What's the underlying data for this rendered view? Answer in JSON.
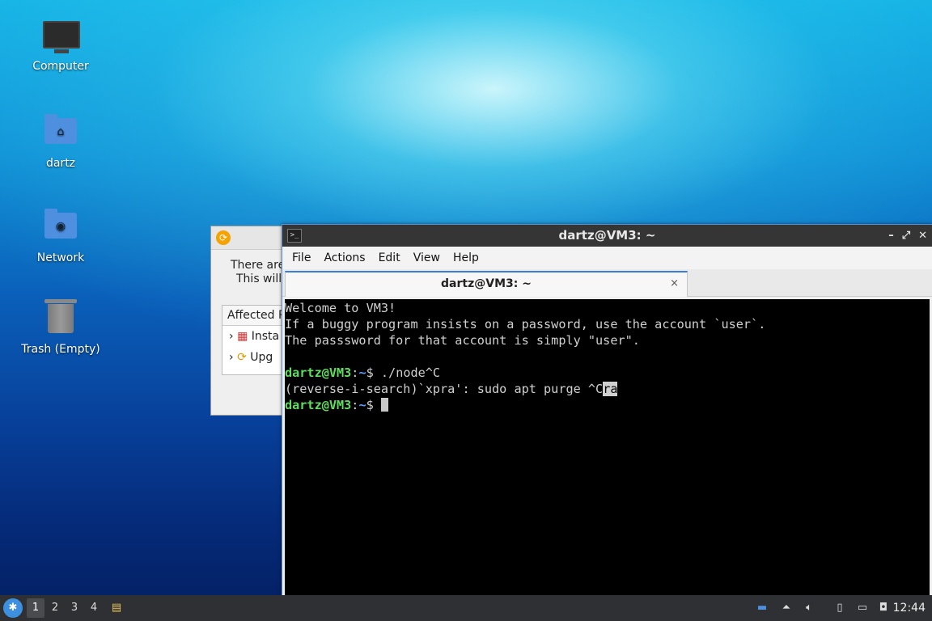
{
  "desktop": {
    "icons": [
      {
        "label": "Computer",
        "icon": "computer-icon"
      },
      {
        "label": "dartz",
        "icon": "home-folder-icon"
      },
      {
        "label": "Network",
        "icon": "network-folder-icon"
      },
      {
        "label": "Trash (Empty)",
        "icon": "trash-icon"
      }
    ]
  },
  "bg_dialog": {
    "message_line1": "There are",
    "message_line2": "This will",
    "section_header": "Affected P",
    "rows": [
      "Insta",
      "Upg"
    ]
  },
  "terminal": {
    "title": "dartz@VM3: ~",
    "menu": [
      "File",
      "Actions",
      "Edit",
      "View",
      "Help"
    ],
    "tab_label": "dartz@VM3: ~",
    "tab_close": "×",
    "window_controls": [
      "–",
      "⤢",
      "✕"
    ],
    "lines": {
      "l1": "Welcome to VM3!",
      "l2": "If a buggy program insists on a password, use the account `user`.",
      "l3": "The passsword for that account is simply \"user\".",
      "prompt_user": "dartz@VM3",
      "prompt_sep": ":",
      "prompt_path": "~",
      "prompt_dollar": "$ ",
      "cmd1": "./node^C",
      "search_prefix": "(reverse-i-search)`xpra': sudo apt purge ^C",
      "search_hl": "ra"
    }
  },
  "taskbar": {
    "workspaces": [
      "1",
      "2",
      "3",
      "4"
    ],
    "active_workspace": "1",
    "clock": "12:44"
  },
  "colors": {
    "prompt_user": "#5fdd5f",
    "prompt_path": "#5f9bff",
    "terminal_bg": "#000000",
    "accent": "#3b7dd8"
  }
}
